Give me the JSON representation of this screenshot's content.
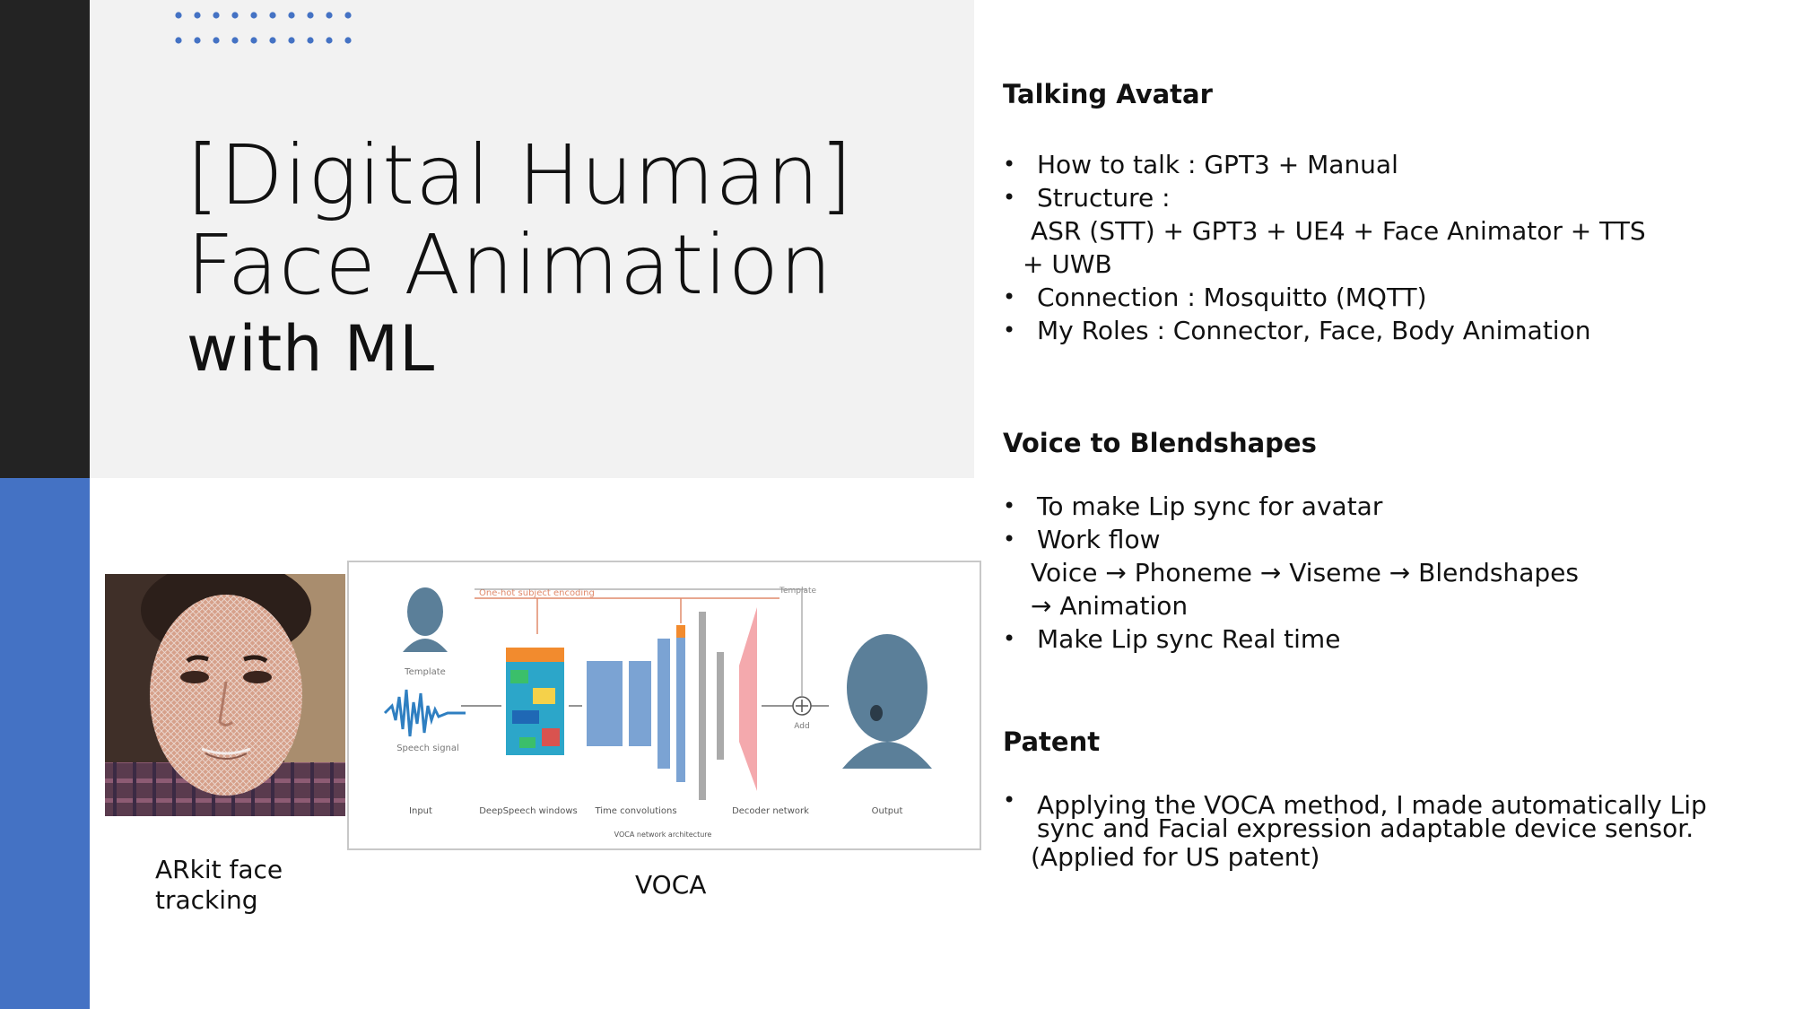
{
  "title": {
    "line1": "[Digital Human]",
    "line2": "Face Animation",
    "line3": "with ML"
  },
  "images": {
    "arkit_caption_line1": "ARkit face",
    "arkit_caption_line2": "tracking",
    "voca_caption": "VOCA",
    "voca_labels": {
      "one_hot": "One-hot subject encoding",
      "template_top": "Template",
      "template": "Template",
      "speech_signal": "Speech signal",
      "add": "Add",
      "input": "Input",
      "deepspeech": "DeepSpeech windows",
      "time_conv": "Time convolutions",
      "decoder": "Decoder network",
      "output": "Output",
      "arch": "VOCA network architecture"
    }
  },
  "sections": {
    "talking_avatar": {
      "title": "Talking Avatar",
      "b1": "How to talk : GPT3 + Manual",
      "b2": "Structure :",
      "b2_cont1": "ASR (STT) + GPT3 + UE4 + Face Animator + TTS",
      "b2_cont2": "+ UWB",
      "b3": "Connection : Mosquitto (MQTT)",
      "b4": "My Roles : Connector, Face, Body Animation"
    },
    "voice_blendshapes": {
      "title": "Voice to Blendshapes",
      "b1": "To make Lip sync for avatar",
      "b2": "Work flow",
      "b2_cont1": "Voice → Phoneme → Viseme → Blendshapes",
      "b2_cont2": "→ Animation",
      "b3": "Make Lip sync Real time"
    },
    "patent": {
      "title": "Patent",
      "b1": "Applying the VOCA method, I made automatically Lip sync and Facial expression adaptable device sensor.",
      "b1_cont": "(Applied for US patent)"
    }
  },
  "colors": {
    "dark_bar": "#232323",
    "accent_blue": "#4472c4",
    "panel_gray": "#f2f2f2"
  }
}
